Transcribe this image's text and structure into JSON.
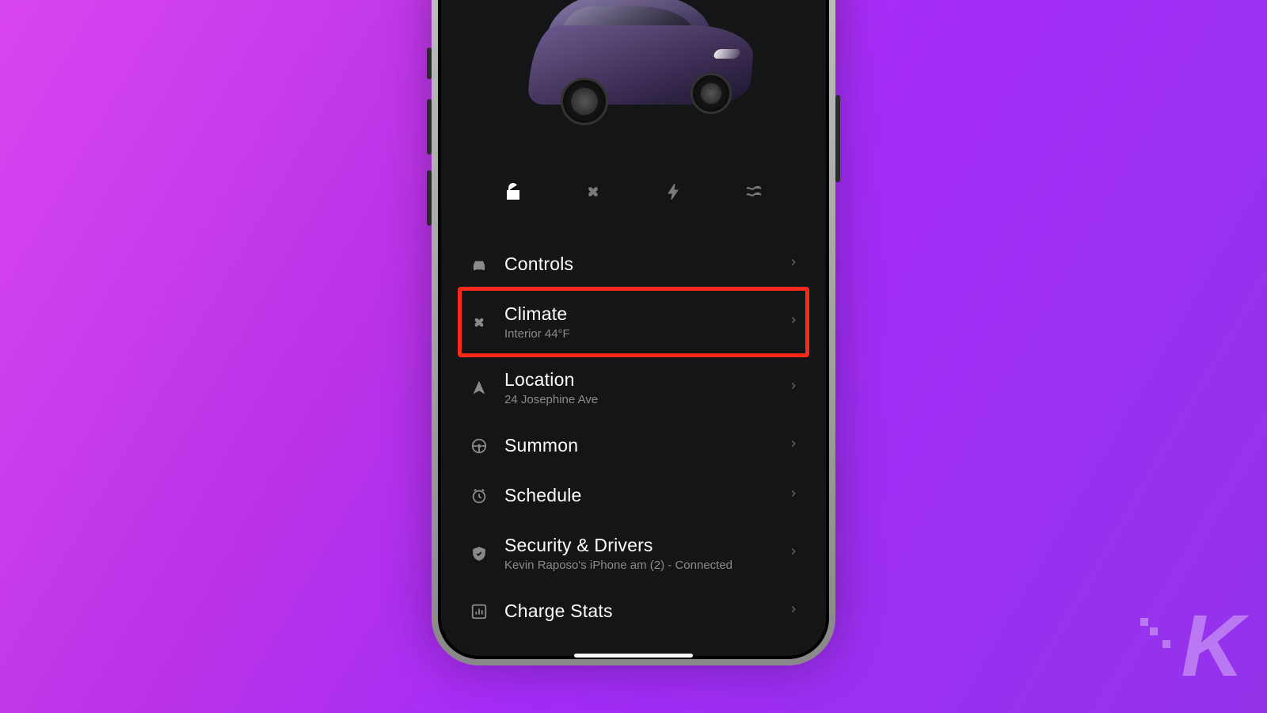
{
  "car": {
    "color": "#4a3e66",
    "model": "sedan"
  },
  "quick_actions": [
    {
      "name": "unlock",
      "active": true
    },
    {
      "name": "climate-fan",
      "active": false
    },
    {
      "name": "charge",
      "active": false
    },
    {
      "name": "vent",
      "active": false
    }
  ],
  "menu": [
    {
      "icon": "car",
      "label": "Controls",
      "sub": "",
      "highlighted": false
    },
    {
      "icon": "fan",
      "label": "Climate",
      "sub": "Interior 44°F",
      "highlighted": true
    },
    {
      "icon": "nav-arrow",
      "label": "Location",
      "sub": "24 Josephine Ave",
      "highlighted": false
    },
    {
      "icon": "steering-wheel",
      "label": "Summon",
      "sub": "",
      "highlighted": false
    },
    {
      "icon": "clock",
      "label": "Schedule",
      "sub": "",
      "highlighted": false
    },
    {
      "icon": "shield",
      "label": "Security & Drivers",
      "sub": "Kevin Raposo's iPhone am (2) - Connected",
      "highlighted": false
    },
    {
      "icon": "bar-chart",
      "label": "Charge Stats",
      "sub": "",
      "highlighted": false
    }
  ],
  "watermark": "K"
}
